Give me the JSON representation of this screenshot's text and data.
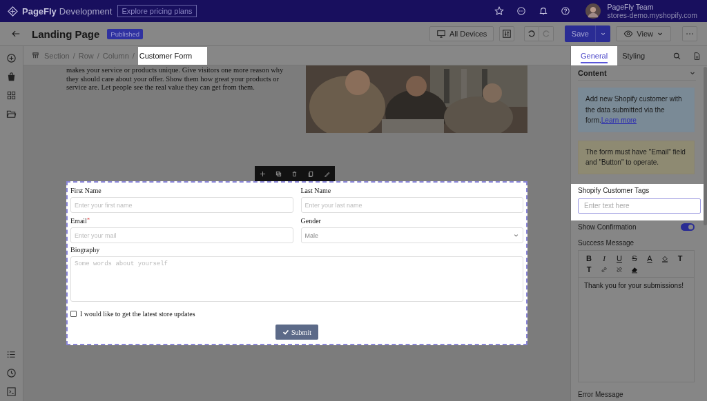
{
  "topbar": {
    "brand": "PageFly",
    "brand_suffix": "Development",
    "pricing_button": "Explore pricing plans",
    "user": {
      "name": "PageFly Team",
      "store": "stores-demo.myshopify.com"
    }
  },
  "header": {
    "title": "Landing Page",
    "status": "Published",
    "device_button": "All Devices",
    "save_button": "Save",
    "view_button": "View"
  },
  "breadcrumb": [
    {
      "label": "Section",
      "selected": false
    },
    {
      "separator": "/",
      "label": "Row",
      "selected": false
    },
    {
      "separator": "/",
      "label": "Column",
      "selected": false
    },
    {
      "separator": "/",
      "label": "Customer Form",
      "selected": true
    }
  ],
  "canvas": {
    "paragraph": "makes your service or products unique. Give visitors one more reason why they should care about your offer. Show them how great your products or service are. Let people see the real value they can get from them.",
    "form": {
      "fields": [
        {
          "kind": "text",
          "label": "First Name",
          "placeholder": "Enter your first name"
        },
        {
          "kind": "text",
          "label": "Last Name",
          "placeholder": "Enter your last name"
        },
        {
          "kind": "text",
          "label": "Email",
          "required_mark": "*",
          "placeholder": "Enter your mail"
        },
        {
          "kind": "select",
          "label": "Gender",
          "value": "Male"
        },
        {
          "kind": "textarea",
          "label": "Biography",
          "placeholder": "Some words about yourself"
        }
      ],
      "checkbox": {
        "label": "I would like to get the latest store updates",
        "checked": false
      },
      "submit": "Submit"
    }
  },
  "panel": {
    "tabs": [
      {
        "label": "General",
        "selected": true
      },
      {
        "label": "Styling",
        "selected": false
      }
    ],
    "section": "Content",
    "notes": [
      {
        "kind": "info",
        "text": "Add new Shopify customer with the data submitted via the form.",
        "link": "Learn more"
      },
      {
        "kind": "warning",
        "text": "The form must have \"Email\" field and \"Button\" to operate."
      }
    ],
    "tags_field": {
      "label": "Shopify Customer Tags",
      "placeholder": "Enter text here"
    },
    "show_confirmation": {
      "label": "Show Confirmation",
      "on": true
    },
    "success_message": {
      "label": "Success Message",
      "tools": [
        {
          "kind": "bold",
          "label": "B"
        },
        {
          "kind": "italic",
          "label": "I"
        },
        {
          "kind": "underline",
          "label": "U"
        },
        {
          "kind": "strike",
          "label": "S"
        },
        {
          "kind": "color",
          "label": "A"
        },
        {
          "kind": "fill"
        },
        {
          "kind": "sup",
          "label": "T"
        },
        {
          "kind": "sub",
          "label": "T"
        },
        {
          "kind": "link"
        },
        {
          "kind": "unlink"
        },
        {
          "kind": "eraser"
        }
      ],
      "value": "Thank you for your submissions!"
    },
    "error_message": {
      "label": "Error Message"
    }
  }
}
